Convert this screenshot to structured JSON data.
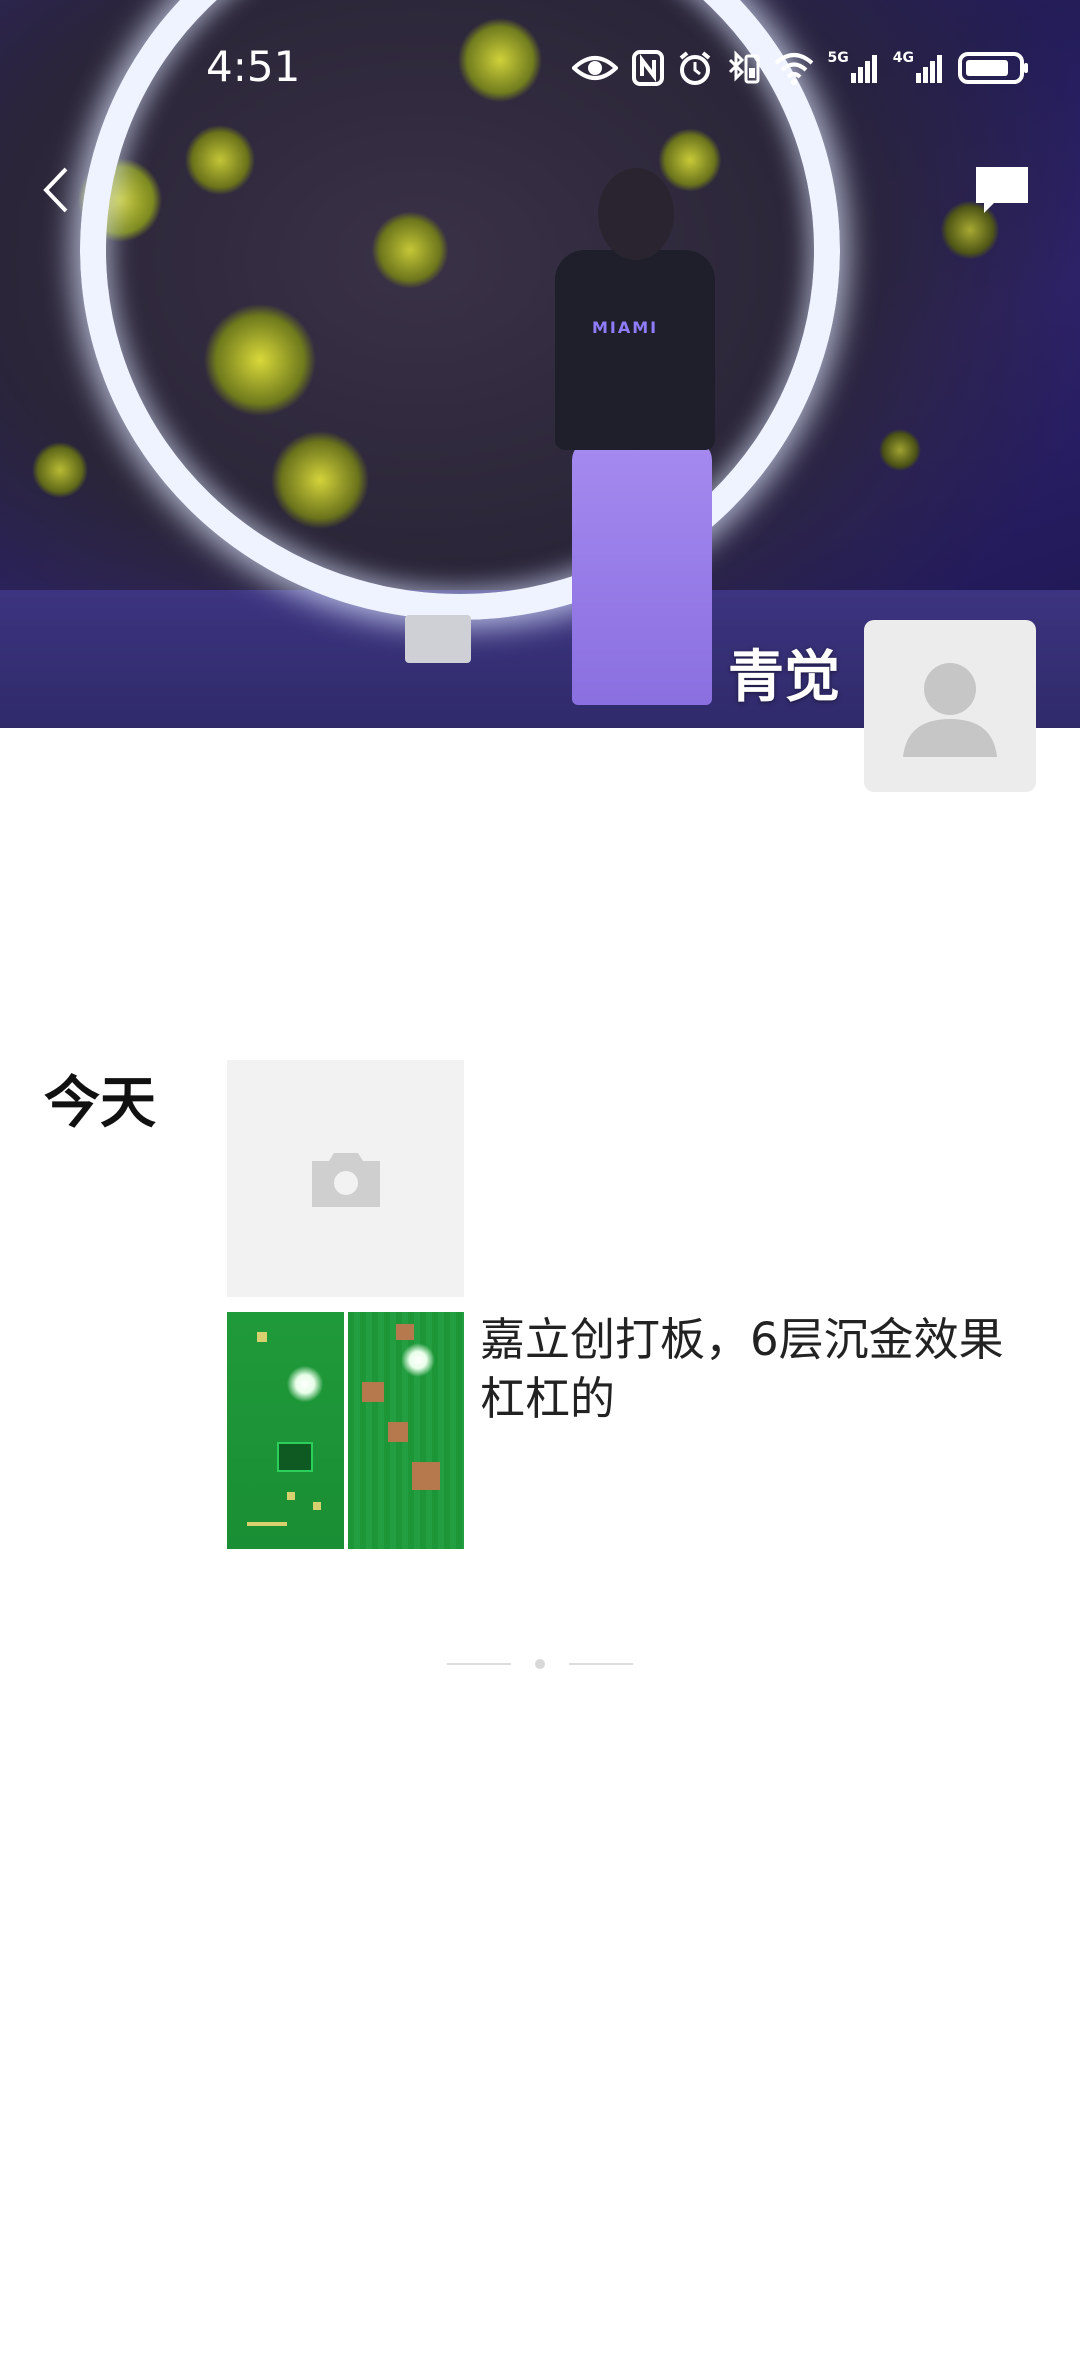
{
  "status_bar": {
    "time": "4:51",
    "network_5g": "5G",
    "network_4g": "4G",
    "icons": [
      "eye-icon",
      "nfc-icon",
      "alarm-icon",
      "bluetooth-icon",
      "wifi-icon",
      "signal-5g-icon",
      "signal-4g-icon",
      "battery-icon"
    ]
  },
  "nav": {
    "back_icon": "chevron-left-icon",
    "message_icon": "message-bubble-icon"
  },
  "cover": {
    "shirt_text": "MIAMI"
  },
  "profile": {
    "name": "青觉",
    "avatar_icon": "default-avatar-icon"
  },
  "feed": {
    "day_label": "今天",
    "camera_icon": "camera-icon",
    "posts": [
      {
        "text": "嘉立创打板，6层沉金效果杠杠的"
      }
    ]
  }
}
